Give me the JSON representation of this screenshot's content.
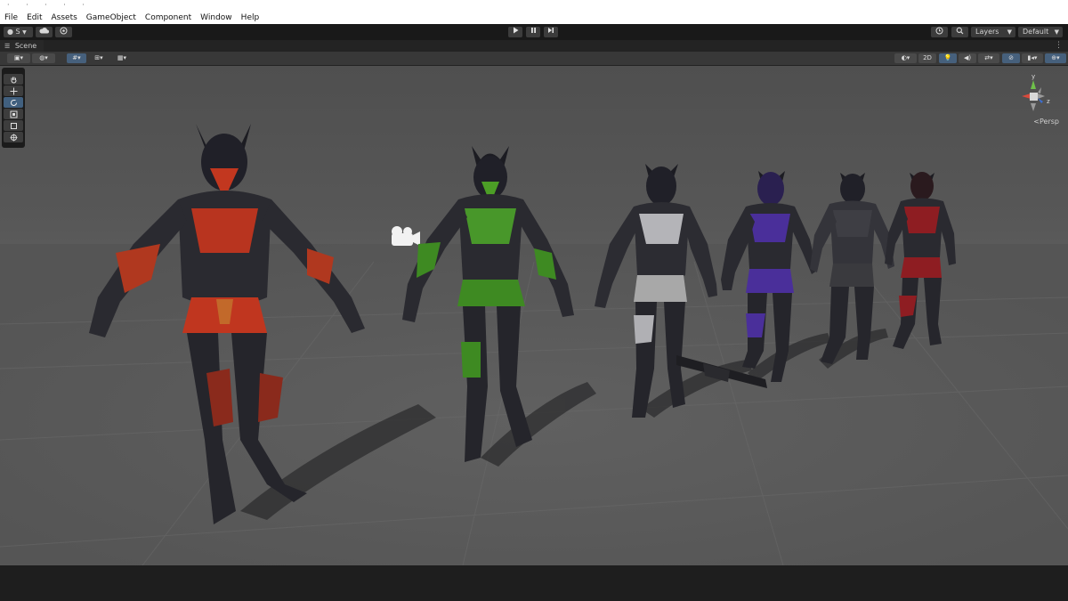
{
  "menubar": {
    "items": [
      "File",
      "Edit",
      "Assets",
      "GameObject",
      "Component",
      "Window",
      "Help"
    ]
  },
  "toolbar": {
    "account_label": "S",
    "cloud_icon": "cloud-icon",
    "collab_icon": "collab-icon",
    "play_icon": "play-icon",
    "pause_icon": "pause-icon",
    "step_icon": "step-icon",
    "history_icon": "history-icon",
    "search_icon": "search-icon",
    "layers_label": "Layers",
    "layout_label": "Default"
  },
  "scene_tab": {
    "label": "Scene"
  },
  "scene_toolbar": {
    "two_d_label": "2D"
  },
  "gizmo": {
    "y_label": "y",
    "z_label": "z",
    "persp_label": "Persp"
  },
  "colors": {
    "accent": "#46607c",
    "red_armor": "#b23420",
    "green_armor": "#3e8a22",
    "white_armor": "#a8a8a8",
    "purple_armor": "#4a2f9a",
    "dark_armor": "#3a3a3e",
    "crimson_armor": "#8e1d22"
  },
  "scene_objects": [
    "red-armored-character",
    "green-armored-character",
    "white-armored-character",
    "purple-armored-character",
    "black-armored-character",
    "crimson-armored-character",
    "rifle",
    "camera-gizmo"
  ]
}
